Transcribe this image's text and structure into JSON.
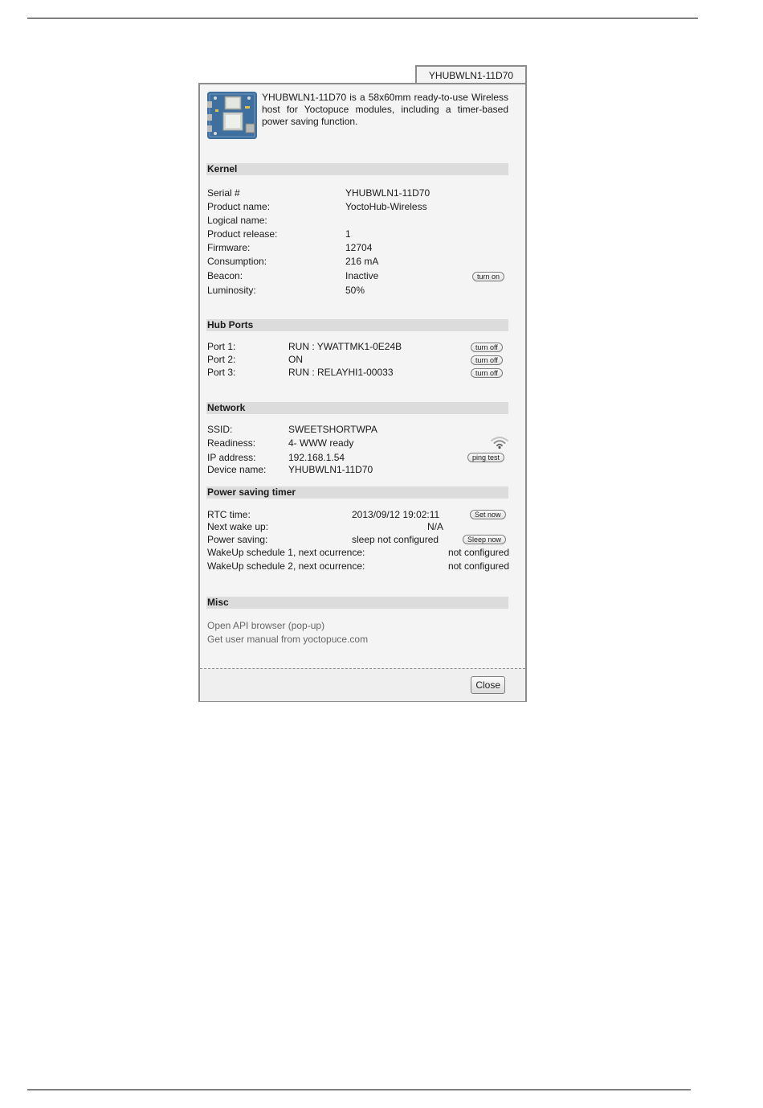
{
  "window": {
    "tab_title": "YHUBWLN1-11D70",
    "close_label": "Close"
  },
  "intro": {
    "description": "YHUBWLN1-11D70 is a 58x60mm ready-to-use Wireless host for Yoctopuce modules, including a timer-based power saving function."
  },
  "kernel": {
    "heading": "Kernel",
    "rows": [
      {
        "label": "Serial #",
        "value": "YHUBWLN1-11D70"
      },
      {
        "label": "Product name:",
        "value": "YoctoHub-Wireless"
      },
      {
        "label": "Logical name:",
        "value": ""
      },
      {
        "label": "Product release:",
        "value": "1"
      },
      {
        "label": "Firmware:",
        "value": "12704"
      },
      {
        "label": "Consumption:",
        "value": "216 mA"
      },
      {
        "label": "Beacon:",
        "value": "Inactive"
      },
      {
        "label": "Luminosity:",
        "value": "50%"
      }
    ],
    "beacon_button": "turn on"
  },
  "hub_ports": {
    "heading": "Hub Ports",
    "rows": [
      {
        "label": "Port 1:",
        "value": "RUN : YWATTMK1-0E24B",
        "button": "turn off"
      },
      {
        "label": "Port 2:",
        "value": "ON",
        "button": "turn off"
      },
      {
        "label": "Port 3:",
        "value": "RUN : RELAYHI1-00033",
        "button": "turn off"
      }
    ]
  },
  "network": {
    "heading": "Network",
    "rows": [
      {
        "label": "SSID:",
        "value": "SWEETSHORTWPA"
      },
      {
        "label": "Readiness:",
        "value": "4- WWW ready"
      },
      {
        "label": "IP address:",
        "value": "192.168.1.54"
      },
      {
        "label": "Device name:",
        "value": "YHUBWLN1-11D70"
      }
    ],
    "ping_button": "ping test",
    "signal_icon": "wifi-signal-icon"
  },
  "power_saving": {
    "heading": "Power saving timer",
    "rtc_label": "RTC time:",
    "rtc_value": "2013/09/12 19:02:11",
    "rtc_button": "Set now",
    "wake_label": "Next wake up:",
    "wake_value": "N/A",
    "ps_label": "Power saving:",
    "ps_value": "sleep not configured",
    "ps_button": "Sleep now",
    "sched1_label": "WakeUp schedule 1, next ocurrence:",
    "sched1_value": "not configured",
    "sched2_label": "WakeUp schedule 2, next ocurrence:",
    "sched2_value": "not configured"
  },
  "misc": {
    "heading": "Misc",
    "api_link": "Open API browser (pop-up)",
    "manual_link": "Get user manual from yoctopuce.com"
  }
}
